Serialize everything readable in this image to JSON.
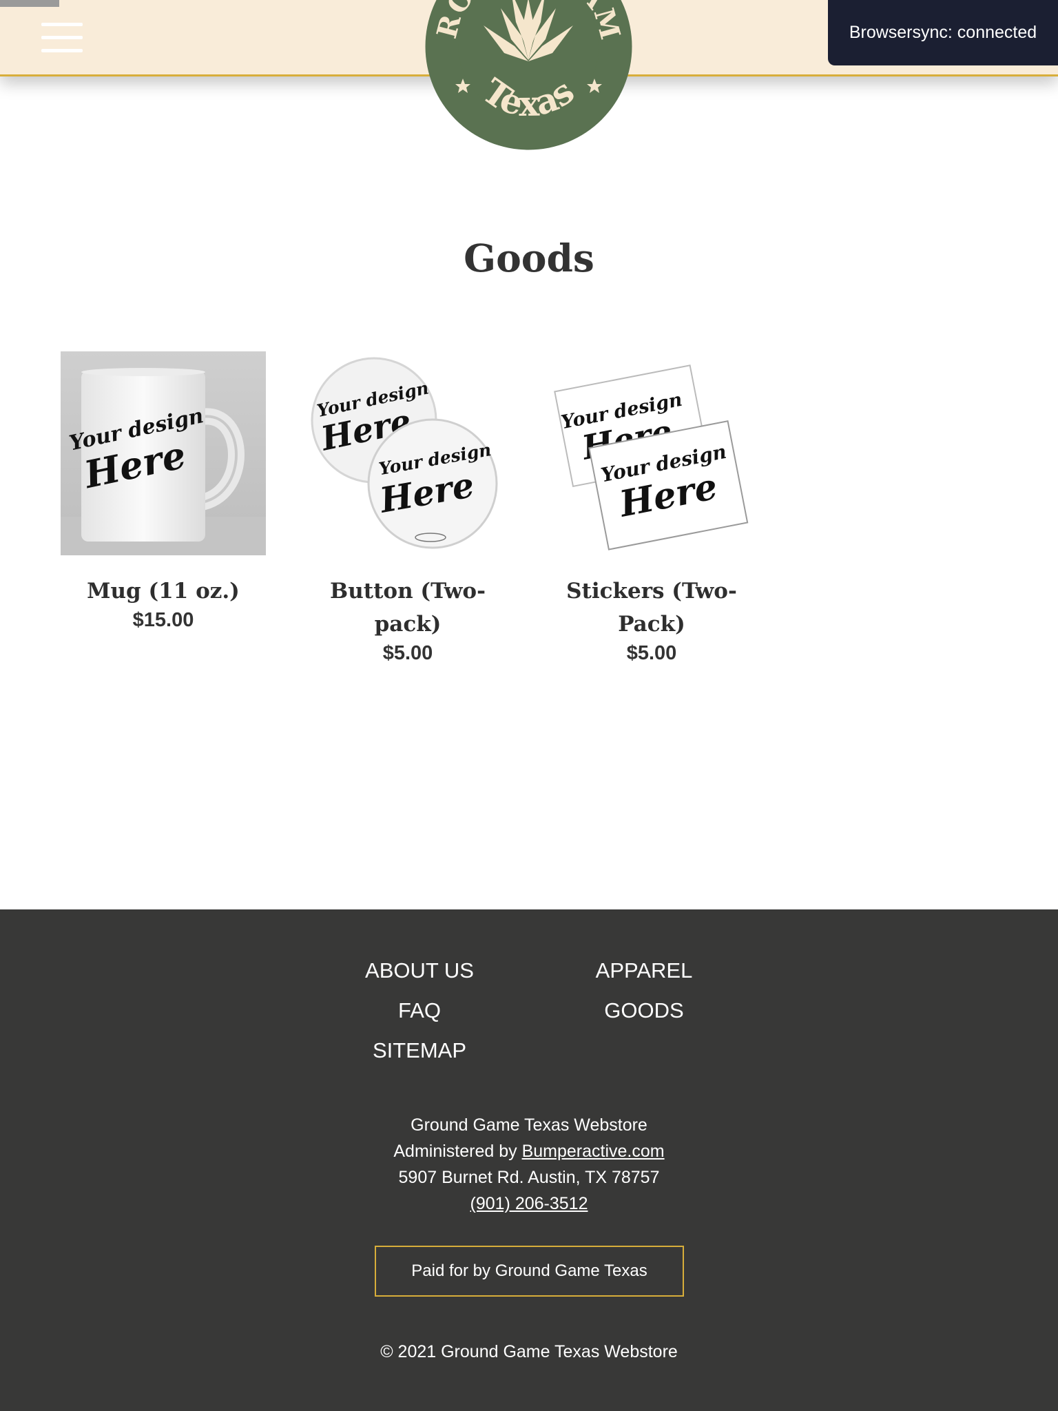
{
  "header": {
    "logo_text_top": "GROUND GAME",
    "logo_text_bottom": "Texas",
    "colors": {
      "header_bg": "#f9ecd9",
      "accent_gold": "#d8ae3a",
      "logo_green": "#5a7251",
      "logo_cream": "#f5e6cc"
    },
    "icons": [
      "hamburger-menu-icon",
      "agave-logo"
    ]
  },
  "browsersync": {
    "message": "Browsersync: connected"
  },
  "page": {
    "title": "Goods"
  },
  "products": [
    {
      "name": "Mug (11 oz.)",
      "price": "$15.00",
      "image_text": [
        "Your design",
        "Here"
      ]
    },
    {
      "name": "Button (Two-pack)",
      "price": "$5.00",
      "image_text": [
        "Your design",
        "Here"
      ]
    },
    {
      "name": "Stickers (Two-Pack)",
      "price": "$5.00",
      "image_text": [
        "Your design",
        "Here"
      ]
    }
  ],
  "footer": {
    "nav_col1": [
      "ABOUT US",
      "FAQ",
      "SITEMAP"
    ],
    "nav_col2": [
      "APPAREL",
      "GOODS"
    ],
    "store_name": "Ground Game Texas Webstore",
    "admin_prefix": "Administered by ",
    "admin_link": "Bumperactive.com",
    "address": "5907 Burnet Rd. Austin, TX 78757",
    "phone": "(901) 206-3512",
    "paid_for": "Paid for by Ground Game Texas",
    "copyright": "© 2021 Ground Game Texas Webstore",
    "colors": {
      "footer_bg": "#383837",
      "border_gold": "#d8ae3a"
    }
  }
}
